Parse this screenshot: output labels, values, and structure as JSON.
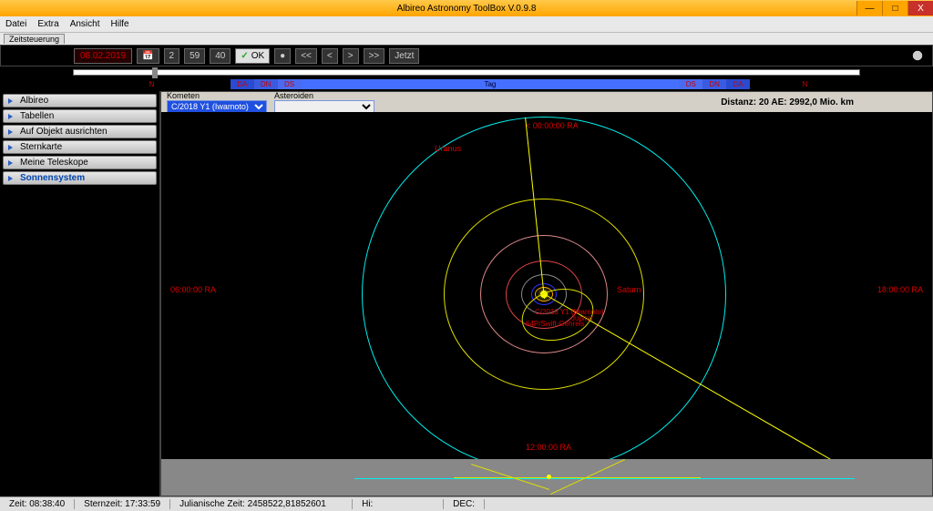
{
  "window": {
    "title": "Albireo Astronomy ToolBox V.0.9.8",
    "min": "—",
    "max": "□",
    "close": "X"
  },
  "menu": [
    "Datei",
    "Extra",
    "Ansicht",
    "Hilfe"
  ],
  "subtab": "Zeitsteuerung",
  "toolbar": {
    "date": "08.02.2019",
    "spin1": "2",
    "spin2": "59",
    "spin3": "40",
    "ok": "OK",
    "back2": "<<",
    "back1": "<",
    "fwd1": ">",
    "fwd2": ">>",
    "now": "Jetzt"
  },
  "daybar": {
    "da": "DA",
    "dn": "DN",
    "ds": "DS",
    "tag": "Tag",
    "n1": "N",
    "n2": "N"
  },
  "sidebar": [
    "Albireo",
    "Tabellen",
    "Auf Objekt ausrichten",
    "Sternkarte",
    "Meine Teleskope",
    "Sonnensystem"
  ],
  "selectors": {
    "kometen_label": "Kometen",
    "asteroiden_label": "Asteroiden",
    "kometen_value": "C/2018 Y1 (Iwamoto)",
    "asteroiden_value": ""
  },
  "distance": "Distanz: 20 AE: 2992,0 Mio. km",
  "labels": {
    "ra00": "< 00:00:00 RA",
    "ra06": "06:00:00 RA",
    "ra12": "12:00:00 RA",
    "ra18": "18:00:00 RA",
    "uranus": "Uranus",
    "saturn": "Saturn",
    "jupiter": "Jupiter",
    "comet": "C/2018 Y1 (Iwamoto)",
    "swift": "64P/Swift-Gehrels"
  },
  "status": {
    "zeit": "Zeit: 08:38:40",
    "stern": "Sternzeit: 17:33:59",
    "jul": "Julianische Zeit: 2458522,81852601",
    "hi": "Hi:",
    "dec": "DEC:"
  }
}
